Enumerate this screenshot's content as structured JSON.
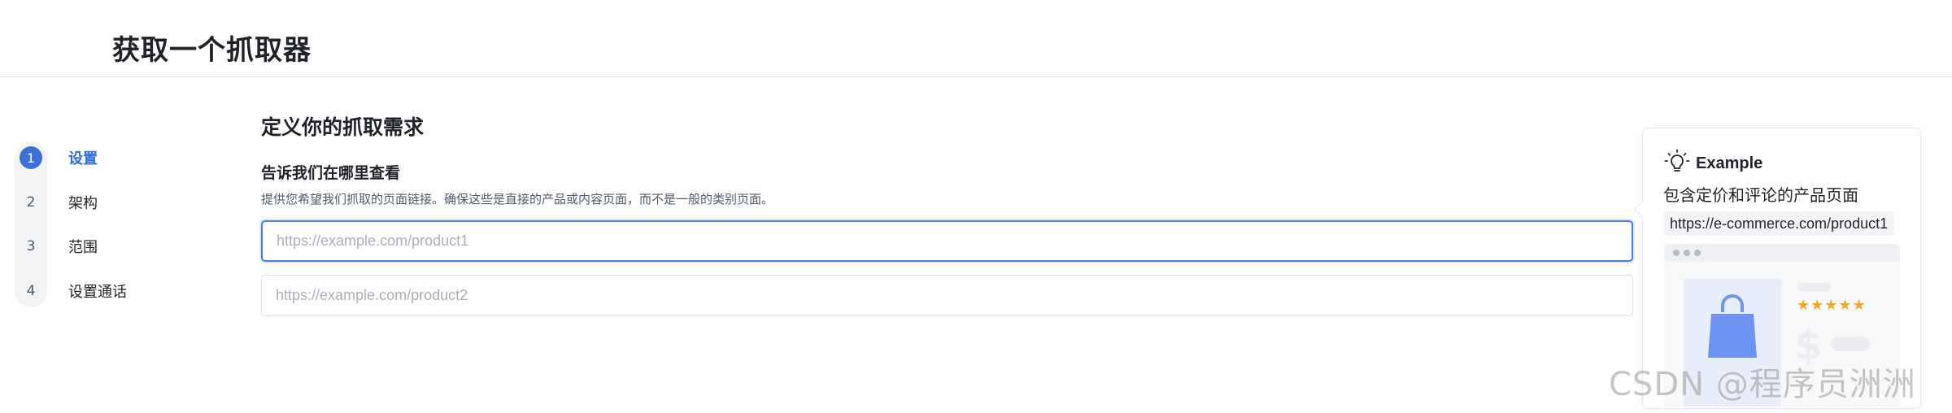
{
  "header": {
    "title": "获取一个抓取器"
  },
  "stepper": {
    "steps": [
      {
        "num": "1",
        "label": "设置",
        "active": true
      },
      {
        "num": "2",
        "label": "架构",
        "active": false
      },
      {
        "num": "3",
        "label": "范围",
        "active": false
      },
      {
        "num": "4",
        "label": "设置通话",
        "active": false
      }
    ]
  },
  "main": {
    "section_title": "定义你的抓取需求",
    "field_title": "告诉我们在哪里查看",
    "field_help": "提供您希望我们抓取的页面链接。确保这些是直接的产品或内容页面，而不是一般的类别页面。",
    "inputs": [
      {
        "value": "",
        "placeholder": "https://example.com/product1"
      },
      {
        "value": "",
        "placeholder": "https://example.com/product2"
      }
    ]
  },
  "example": {
    "icon": "lightbulb-icon",
    "label": "Example",
    "description": "包含定价和评论的产品页面",
    "url": "https://e-commerce.com/product1",
    "stars": "★★★★★",
    "dollar": "$"
  },
  "watermark": "CSDN @程序员洲洲",
  "colors": {
    "accent": "#2f6cdb",
    "active_step_bg": "#3b6fd9",
    "focus_border": "#4a7ee6",
    "star": "#f5a623"
  }
}
